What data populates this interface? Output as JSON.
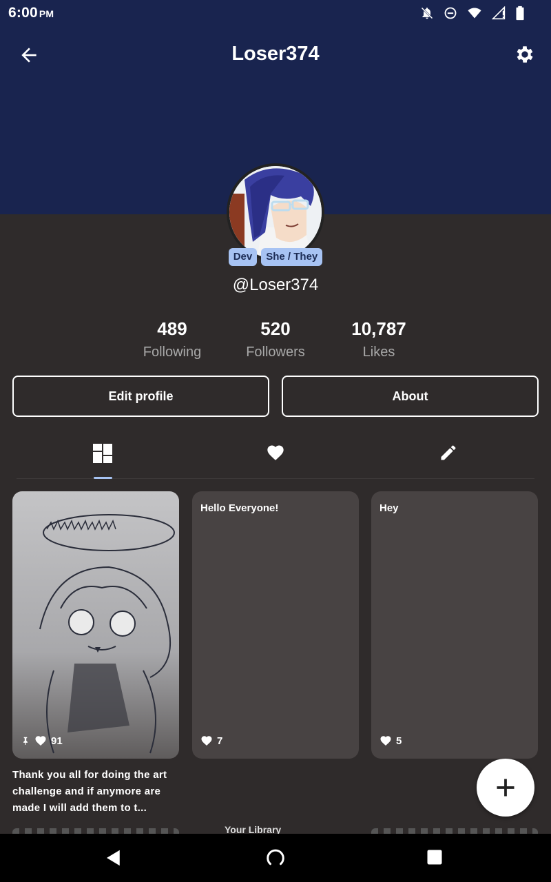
{
  "status_bar": {
    "time": "6:00",
    "ampm": "PM",
    "icons": [
      "bell-off-icon",
      "do-not-disturb-icon",
      "wifi-icon",
      "signal-icon",
      "battery-icon"
    ]
  },
  "header": {
    "title": "Loser374",
    "back_icon": "arrow-left-icon",
    "settings_icon": "gear-icon",
    "background_color": "#19244f"
  },
  "profile": {
    "badges": [
      "Dev",
      "She / They"
    ],
    "handle": "@Loser374",
    "badge_color": "#a7c3f3"
  },
  "stats": [
    {
      "value": "489",
      "label": "Following"
    },
    {
      "value": "520",
      "label": "Followers"
    },
    {
      "value": "10,787",
      "label": "Likes"
    }
  ],
  "buttons": {
    "edit_profile": "Edit profile",
    "about": "About"
  },
  "tabs": [
    {
      "icon": "grid-icon",
      "selected": true
    },
    {
      "icon": "heart-icon",
      "selected": false
    },
    {
      "icon": "pencil-icon",
      "selected": false
    }
  ],
  "cards": [
    {
      "text": "",
      "likes": "91",
      "pinned": true,
      "type": "image"
    },
    {
      "text": "Hello Everyone!",
      "likes": "7",
      "pinned": false,
      "type": "text"
    },
    {
      "text": "Hey",
      "likes": "5",
      "pinned": false,
      "type": "text"
    }
  ],
  "caption": "Thank you all for doing the art challenge and if anymore are made I will add them to t...",
  "peek_text": "Your Library",
  "fab_icon": "plus-icon",
  "nav": [
    "back-triangle-icon",
    "home-circle-icon",
    "recents-square-icon"
  ]
}
